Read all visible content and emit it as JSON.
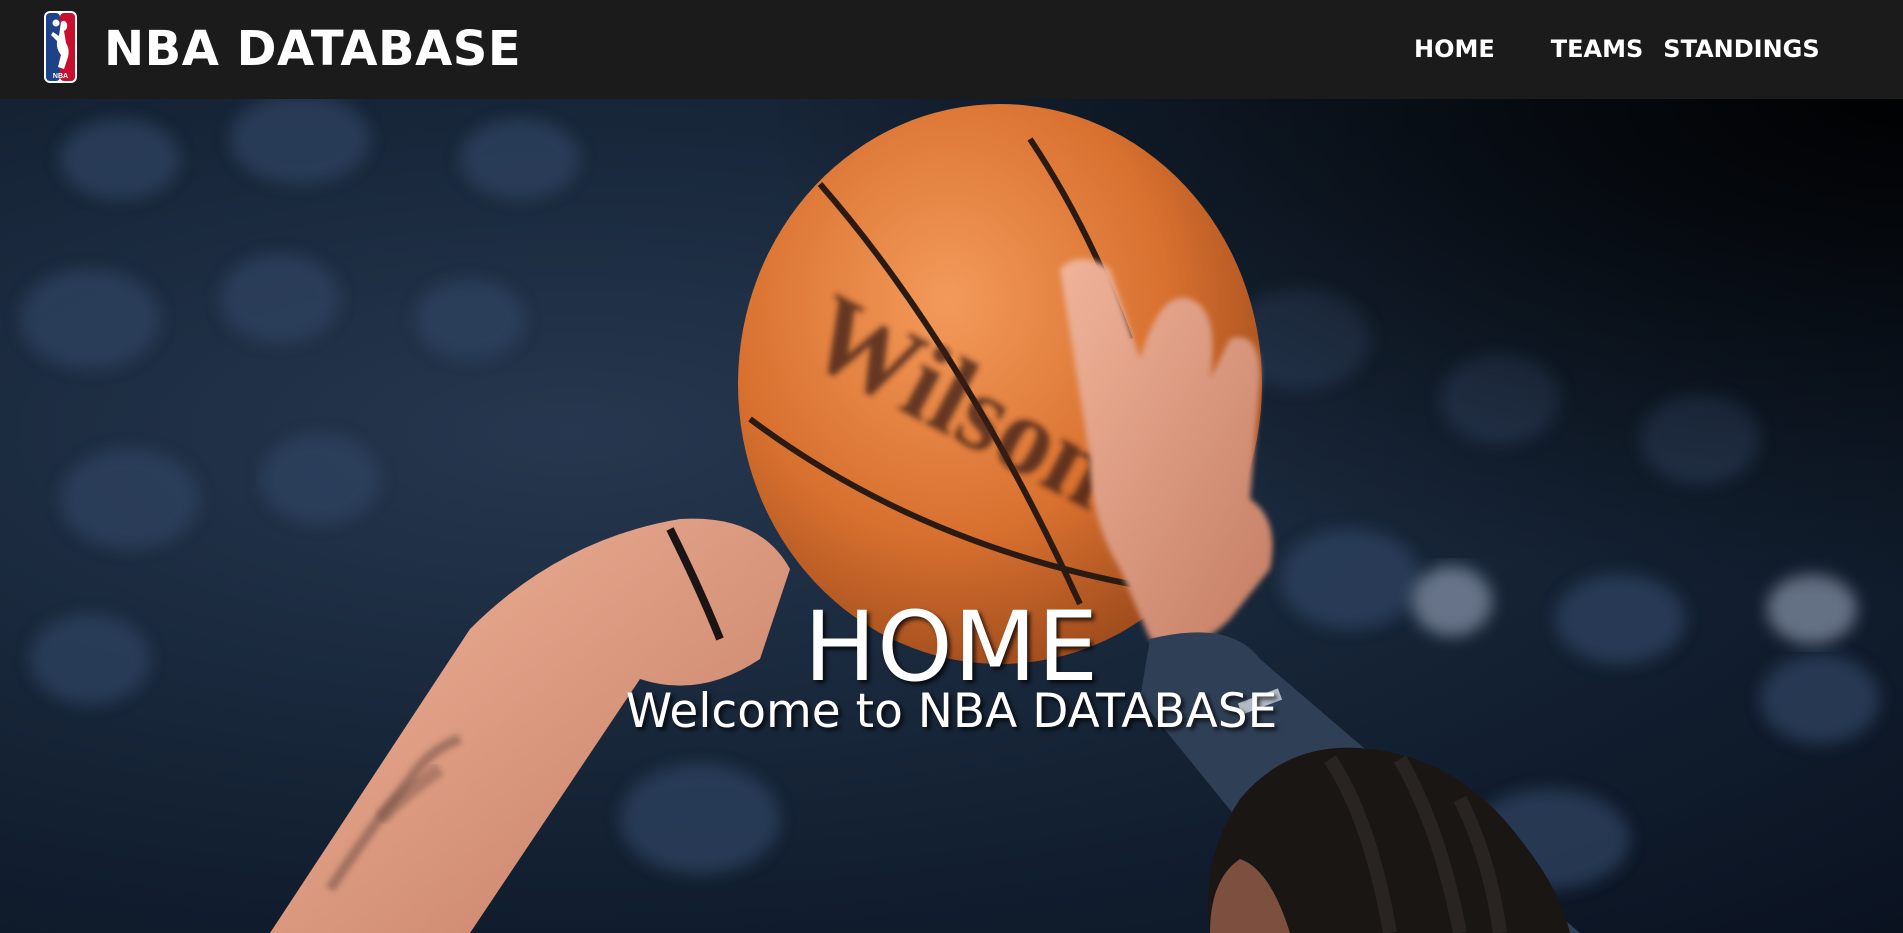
{
  "header": {
    "brand": "NBA DATABASE",
    "logo_icon": "nba-logo-icon",
    "nav": [
      {
        "label": "HOME"
      },
      {
        "label": "TEAMS"
      },
      {
        "label": "STANDINGS"
      }
    ]
  },
  "hero": {
    "title": "HOME",
    "subtitle": "Welcome to NBA DATABASE",
    "background_image": "basketball-shot-photo",
    "ball_brand": "Wilson"
  },
  "colors": {
    "navbar": "#1b1b1b",
    "text": "#ffffff",
    "logo_blue": "#1d428a",
    "logo_red": "#c8102e"
  }
}
